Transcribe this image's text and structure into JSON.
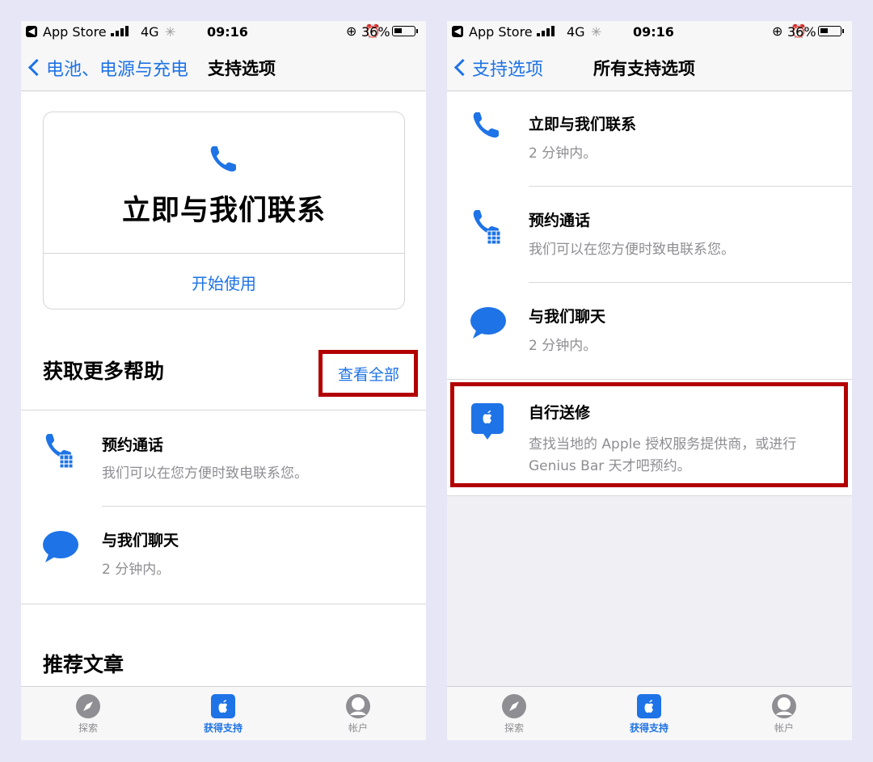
{
  "status_bar": {
    "carrier_app": "App Store",
    "network": "4G",
    "time": "09:16",
    "battery": "36%"
  },
  "left": {
    "nav": {
      "back_label": "电池、电源与充电",
      "title": "支持选项"
    },
    "contact_card": {
      "title": "立即与我们联系",
      "action": "开始使用"
    },
    "more_help": {
      "title": "获取更多帮助",
      "see_all": "查看全部"
    },
    "rows": [
      {
        "title": "预约通话",
        "subtitle": "我们可以在您方便时致电联系您。"
      },
      {
        "title": "与我们聊天",
        "subtitle": "2 分钟内。"
      }
    ],
    "articles_title": "推荐文章"
  },
  "right": {
    "nav": {
      "back_label": "支持选项",
      "title": "所有支持选项"
    },
    "rows": [
      {
        "title": "立即与我们联系",
        "subtitle": "2 分钟内。"
      },
      {
        "title": "预约通话",
        "subtitle": "我们可以在您方便时致电联系您。"
      },
      {
        "title": "与我们聊天",
        "subtitle": "2 分钟内。"
      },
      {
        "title": "自行送修",
        "subtitle": "查找当地的 Apple 授权服务提供商，或进行 Genius Bar 天才吧预约。"
      }
    ]
  },
  "tabbar": [
    {
      "label": "探索",
      "icon": "compass-icon"
    },
    {
      "label": "获得支持",
      "icon": "apple-support-icon",
      "active": true
    },
    {
      "label": "帐户",
      "icon": "account-icon"
    }
  ],
  "colors": {
    "accent": "#1e73e6",
    "highlight": "#b20000",
    "background": "#e6e6f7"
  }
}
